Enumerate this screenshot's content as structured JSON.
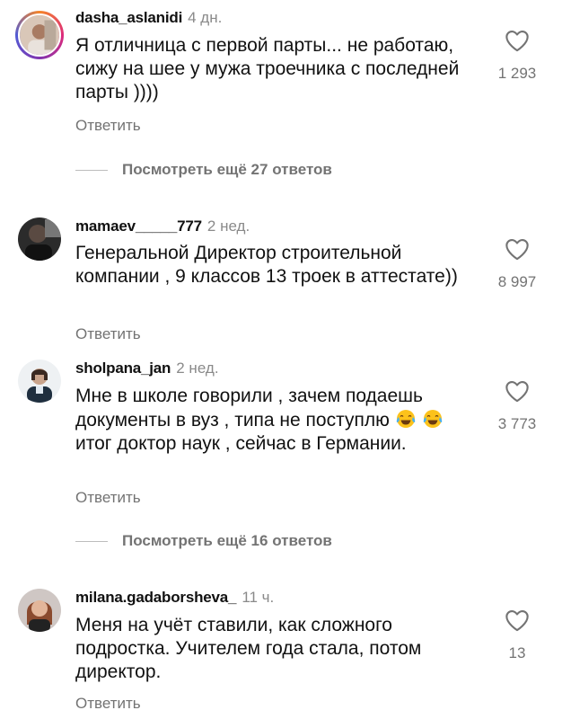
{
  "comments": [
    {
      "username": "dasha_aslanidi",
      "time": "4 дн.",
      "text": "Я отличница с первой парты... не работаю, сижу на шее у мужа троечника с последней парты ))))",
      "likes": "1 293",
      "reply_label": "Ответить",
      "view_more": "Посмотреть ещё 27 ответов"
    },
    {
      "username": "mamaev_____777",
      "time": "2 нед.",
      "text": "Генеральной Директор строительной компании , 9 классов 13 троек в аттестате))",
      "likes": "8 997",
      "reply_label": "Ответить"
    },
    {
      "username": "sholpana_jan",
      "time": "2 нед.",
      "text_part1": "Мне в школе говорили , зачем подаешь документы в вуз , типа не поступлю",
      "text_part2": "итог доктор наук , сейчас в Германии.",
      "likes": "3 773",
      "reply_label": "Ответить",
      "view_more": "Посмотреть ещё 16 ответов"
    },
    {
      "username": "milana.gadaborsheva_",
      "time": "11 ч.",
      "text": "Меня на учёт ставили, как сложного подростка. Учителем года стала, потом директор.",
      "likes": "13",
      "reply_label": "Ответить"
    }
  ],
  "icons": {
    "like": "heart-outline-icon",
    "emoji": "tears-of-joy-emoji"
  }
}
